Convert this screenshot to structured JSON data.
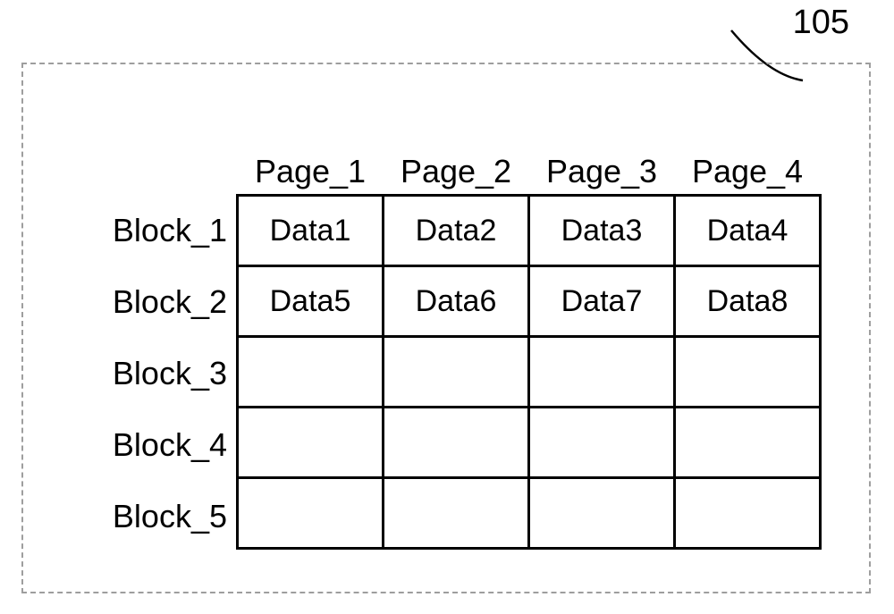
{
  "reference_number": "105",
  "columns": [
    "Page_1",
    "Page_2",
    "Page_3",
    "Page_4"
  ],
  "rows": [
    "Block_1",
    "Block_2",
    "Block_3",
    "Block_4",
    "Block_5"
  ],
  "cells": [
    [
      "Data1",
      "Data2",
      "Data3",
      "Data4"
    ],
    [
      "Data5",
      "Data6",
      "Data7",
      "Data8"
    ],
    [
      "",
      "",
      "",
      ""
    ],
    [
      "",
      "",
      "",
      ""
    ],
    [
      "",
      "",
      "",
      ""
    ]
  ]
}
